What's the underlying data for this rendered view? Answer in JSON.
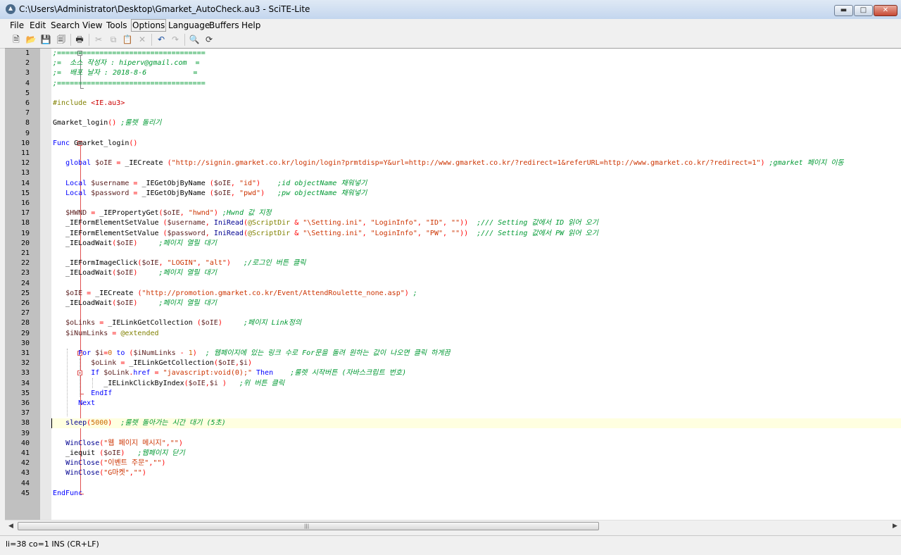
{
  "window": {
    "title": "C:\\Users\\Administrator\\Desktop\\Gmarket_AutoCheck.au3 - SciTE-Lite"
  },
  "menu": [
    "File",
    "Edit",
    "Search",
    "View",
    "Tools",
    "Options",
    "Language",
    "Buffers",
    "Help"
  ],
  "toolbar": {
    "icons": [
      "new-file-icon",
      "open-folder-icon",
      "save-icon",
      "close-file-icon",
      "print-icon",
      "cut-icon",
      "copy-icon",
      "paste-icon",
      "delete-icon",
      "undo-icon",
      "redo-icon",
      "find-icon",
      "replace-icon"
    ]
  },
  "editor": {
    "current_line": 38,
    "lines": [
      [
        [
          "cm",
          ";==================================="
        ]
      ],
      [
        [
          "cm",
          ";=  소스 작성자 : hiperv@gmail.com  ="
        ]
      ],
      [
        [
          "cm",
          ";=  배포 날자 : 2018-8-6           ="
        ]
      ],
      [
        [
          "cm",
          ";==================================="
        ]
      ],
      [],
      [
        [
          "mc",
          "#include "
        ],
        [
          "inc",
          "<IE.au3>"
        ]
      ],
      [],
      [
        [
          "",
          "Gmarket_login"
        ],
        [
          "op",
          "() "
        ],
        [
          "cm",
          ";룰렛 돌리기"
        ]
      ],
      [],
      [
        [
          "kw",
          "Func "
        ],
        [
          "",
          "Gmarket_login"
        ],
        [
          "op",
          "()"
        ]
      ],
      [],
      [
        [
          "",
          "   "
        ],
        [
          "kw",
          "global "
        ],
        [
          "va",
          "$oIE "
        ],
        [
          "op",
          "= "
        ],
        [
          "",
          "_IECreate "
        ],
        [
          "op",
          "("
        ],
        [
          "st",
          "\"http://signin.gmarket.co.kr/login/login?prmtdisp=Y&url=http://www.gmarket.co.kr/?redirect=1&referURL=http://www.gmarket.co.kr/?redirect=1\""
        ],
        [
          "op",
          ") "
        ],
        [
          "cm",
          ";gmarket 페이지 이동"
        ]
      ],
      [],
      [
        [
          "",
          "   "
        ],
        [
          "kw",
          "Local "
        ],
        [
          "va",
          "$username "
        ],
        [
          "op",
          "= "
        ],
        [
          "",
          "_IEGetObjByName "
        ],
        [
          "op",
          "("
        ],
        [
          "va",
          "$oIE"
        ],
        [
          "op",
          ", "
        ],
        [
          "st",
          "\"id\""
        ],
        [
          "op",
          ")    "
        ],
        [
          "cm",
          ";id objectName 채워넣기"
        ]
      ],
      [
        [
          "",
          "   "
        ],
        [
          "kw",
          "Local "
        ],
        [
          "va",
          "$password "
        ],
        [
          "op",
          "= "
        ],
        [
          "",
          "_IEGetObjByName "
        ],
        [
          "op",
          "("
        ],
        [
          "va",
          "$oIE"
        ],
        [
          "op",
          ", "
        ],
        [
          "st",
          "\"pwd\""
        ],
        [
          "op",
          ")   "
        ],
        [
          "cm",
          ";pw objectName 채워넣기"
        ]
      ],
      [],
      [
        [
          "",
          "   "
        ],
        [
          "va",
          "$HWND "
        ],
        [
          "op",
          "= "
        ],
        [
          "",
          "_IEPropertyGet"
        ],
        [
          "op",
          "("
        ],
        [
          "va",
          "$oIE"
        ],
        [
          "op",
          ", "
        ],
        [
          "st",
          "\"hwnd\""
        ],
        [
          "op",
          ") "
        ],
        [
          "cm",
          ";Hwnd 값 지정"
        ]
      ],
      [
        [
          "",
          "   _IEFormElementSetValue "
        ],
        [
          "op",
          "("
        ],
        [
          "va",
          "$username"
        ],
        [
          "op",
          ", "
        ],
        [
          "fn",
          "IniRead"
        ],
        [
          "op",
          "("
        ],
        [
          "mc",
          "@ScriptDir "
        ],
        [
          "op",
          "& "
        ],
        [
          "st",
          "\"\\Setting.ini\""
        ],
        [
          "op",
          ", "
        ],
        [
          "st",
          "\"LoginInfo\""
        ],
        [
          "op",
          ", "
        ],
        [
          "st",
          "\"ID\""
        ],
        [
          "op",
          ", "
        ],
        [
          "st",
          "\"\""
        ],
        [
          "op",
          "))  "
        ],
        [
          "cm",
          ";/// Setting 값에서 ID 읽어 오기"
        ]
      ],
      [
        [
          "",
          "   _IEFormElementSetValue "
        ],
        [
          "op",
          "("
        ],
        [
          "va",
          "$password"
        ],
        [
          "op",
          ", "
        ],
        [
          "fn",
          "IniRead"
        ],
        [
          "op",
          "("
        ],
        [
          "mc",
          "@ScriptDir "
        ],
        [
          "op",
          "& "
        ],
        [
          "st",
          "\"\\Setting.ini\""
        ],
        [
          "op",
          ", "
        ],
        [
          "st",
          "\"LoginInfo\""
        ],
        [
          "op",
          ", "
        ],
        [
          "st",
          "\"PW\""
        ],
        [
          "op",
          ", "
        ],
        [
          "st",
          "\"\""
        ],
        [
          "op",
          "))  "
        ],
        [
          "cm",
          ";/// Setting 값에서 PW 읽어 오기"
        ]
      ],
      [
        [
          "",
          "   _IELoadWait"
        ],
        [
          "op",
          "("
        ],
        [
          "va",
          "$oIE"
        ],
        [
          "op",
          ")     "
        ],
        [
          "cm",
          ";페이지 열릴 대기"
        ]
      ],
      [],
      [
        [
          "",
          "   _IEFormImageClick"
        ],
        [
          "op",
          "("
        ],
        [
          "va",
          "$oIE"
        ],
        [
          "op",
          ", "
        ],
        [
          "st",
          "\"LOGIN\""
        ],
        [
          "op",
          ", "
        ],
        [
          "st",
          "\"alt\""
        ],
        [
          "op",
          ")   "
        ],
        [
          "cm",
          ";/로그인 버튼 클릭"
        ]
      ],
      [
        [
          "",
          "   _IELoadWait"
        ],
        [
          "op",
          "("
        ],
        [
          "va",
          "$oIE"
        ],
        [
          "op",
          ")     "
        ],
        [
          "cm",
          ";페이지 열릴 대기"
        ]
      ],
      [],
      [
        [
          "",
          "   "
        ],
        [
          "va",
          "$oIE "
        ],
        [
          "op",
          "= "
        ],
        [
          "",
          "_IECreate "
        ],
        [
          "op",
          "("
        ],
        [
          "st",
          "\"http://promotion.gmarket.co.kr/Event/AttendRoulette_none.asp\""
        ],
        [
          "op",
          ") "
        ],
        [
          "cm",
          ";"
        ]
      ],
      [
        [
          "",
          "   _IELoadWait"
        ],
        [
          "op",
          "("
        ],
        [
          "va",
          "$oIE"
        ],
        [
          "op",
          ")     "
        ],
        [
          "cm",
          ";페이지 열릴 대기"
        ]
      ],
      [],
      [
        [
          "",
          "   "
        ],
        [
          "va",
          "$oLinks "
        ],
        [
          "op",
          "= "
        ],
        [
          "",
          "_IELinkGetCollection "
        ],
        [
          "op",
          "("
        ],
        [
          "va",
          "$oIE"
        ],
        [
          "op",
          ")     "
        ],
        [
          "cm",
          ";페이지 Link정의"
        ]
      ],
      [
        [
          "",
          "   "
        ],
        [
          "va",
          "$iNumLinks "
        ],
        [
          "op",
          "= "
        ],
        [
          "mc",
          "@extended"
        ]
      ],
      [],
      [
        [
          "",
          "      "
        ],
        [
          "kw",
          "For "
        ],
        [
          "va",
          "$i"
        ],
        [
          "op",
          "="
        ],
        [
          "nm",
          "0 "
        ],
        [
          "kw",
          "to "
        ],
        [
          "op",
          "("
        ],
        [
          "va",
          "$iNumLinks "
        ],
        [
          "op",
          "- "
        ],
        [
          "nm",
          "1"
        ],
        [
          "op",
          ")  "
        ],
        [
          "cm",
          "; 웹페이지에 있는 링크 수로 For문을 돌려 원하는 값이 나오면 클릭 하게끔"
        ]
      ],
      [
        [
          "",
          "         "
        ],
        [
          "va",
          "$oLink "
        ],
        [
          "op",
          "= "
        ],
        [
          "",
          "_IELinkGetCollection"
        ],
        [
          "op",
          "("
        ],
        [
          "va",
          "$oIE"
        ],
        [
          "op",
          ","
        ],
        [
          "va",
          "$i"
        ],
        [
          "op",
          ")"
        ]
      ],
      [
        [
          "",
          "         "
        ],
        [
          "kw",
          "If "
        ],
        [
          "va",
          "$oLink"
        ],
        [
          "op",
          "."
        ],
        [
          "kw",
          "href "
        ],
        [
          "op",
          "= "
        ],
        [
          "st",
          "\"javascript:void(0);\" "
        ],
        [
          "kw",
          "Then    "
        ],
        [
          "cm",
          ";룰렛 시작버튼 (자바스크립트 번호)"
        ]
      ],
      [
        [
          "",
          "            _IELinkClickByIndex"
        ],
        [
          "op",
          "("
        ],
        [
          "va",
          "$oIE"
        ],
        [
          "op",
          ","
        ],
        [
          "va",
          "$i "
        ],
        [
          "op",
          ")   "
        ],
        [
          "cm",
          ";위 버튼 클릭"
        ]
      ],
      [
        [
          "",
          "         "
        ],
        [
          "kw",
          "EndIf"
        ]
      ],
      [
        [
          "",
          "      "
        ],
        [
          "kw",
          "Next"
        ]
      ],
      [],
      [
        [
          "",
          "   "
        ],
        [
          "fn",
          "sleep"
        ],
        [
          "op",
          "("
        ],
        [
          "nm",
          "5000"
        ],
        [
          "op",
          ")  "
        ],
        [
          "cm",
          ";룰렛 돌아가는 시간 대기 (5초)"
        ]
      ],
      [],
      [
        [
          "",
          "   "
        ],
        [
          "fn",
          "WinClose"
        ],
        [
          "op",
          "("
        ],
        [
          "st",
          "\"웹 페이지 메시지\""
        ],
        [
          "op",
          ","
        ],
        [
          "st",
          "\"\""
        ],
        [
          "op",
          ")"
        ]
      ],
      [
        [
          "",
          "   _iequit "
        ],
        [
          "op",
          "("
        ],
        [
          "va",
          "$oIE"
        ],
        [
          "op",
          ")   "
        ],
        [
          "cm",
          ";웹페이지 닫기"
        ]
      ],
      [
        [
          "",
          "   "
        ],
        [
          "fn",
          "WinClose"
        ],
        [
          "op",
          "("
        ],
        [
          "st",
          "\"이벤트 주문\""
        ],
        [
          "op",
          ","
        ],
        [
          "st",
          "\"\""
        ],
        [
          "op",
          ")"
        ]
      ],
      [
        [
          "",
          "   "
        ],
        [
          "fn",
          "WinClose"
        ],
        [
          "op",
          "("
        ],
        [
          "st",
          "\"G마켓\""
        ],
        [
          "op",
          ","
        ],
        [
          "st",
          "\"\""
        ],
        [
          "op",
          ")"
        ]
      ],
      [],
      [
        [
          "kw",
          "EndFunc"
        ]
      ]
    ]
  },
  "statusbar": {
    "text": "li=38 co=1 INS (CR+LF)"
  }
}
